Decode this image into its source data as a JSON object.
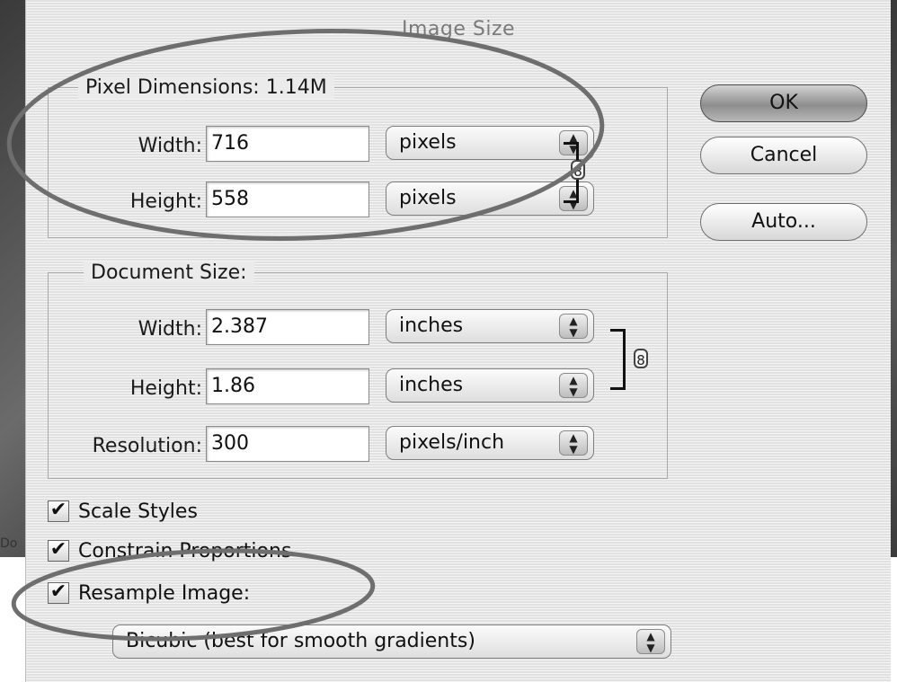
{
  "dialog": {
    "title": "Image Size",
    "stray_text": "Do"
  },
  "pixel_dimensions": {
    "label": "Pixel Dimensions:",
    "size": "1.14M",
    "width_label": "Width:",
    "width_value": "716",
    "width_unit": "pixels",
    "height_label": "Height:",
    "height_value": "558",
    "height_unit": "pixels",
    "link_icon": "chain-link-icon"
  },
  "document_size": {
    "label": "Document Size:",
    "width_label": "Width:",
    "width_value": "2.387",
    "width_unit": "inches",
    "height_label": "Height:",
    "height_value": "1.86",
    "height_unit": "inches",
    "resolution_label": "Resolution:",
    "resolution_value": "300",
    "resolution_unit": "pixels/inch",
    "link_icon": "chain-link-icon"
  },
  "buttons": {
    "ok": "OK",
    "cancel": "Cancel",
    "auto": "Auto..."
  },
  "options": {
    "scale_styles": {
      "label": "Scale Styles",
      "checked": true
    },
    "constrain_proportions": {
      "label": "Constrain Proportions",
      "checked": true
    },
    "resample_image": {
      "label": "Resample Image:",
      "checked": true
    },
    "resample_method": "Bicubic (best for smooth gradients)",
    "check_glyph": "✔"
  },
  "colors": {
    "dialog_bg": "#e9e9e9",
    "annotation": "#6e6e6e"
  }
}
